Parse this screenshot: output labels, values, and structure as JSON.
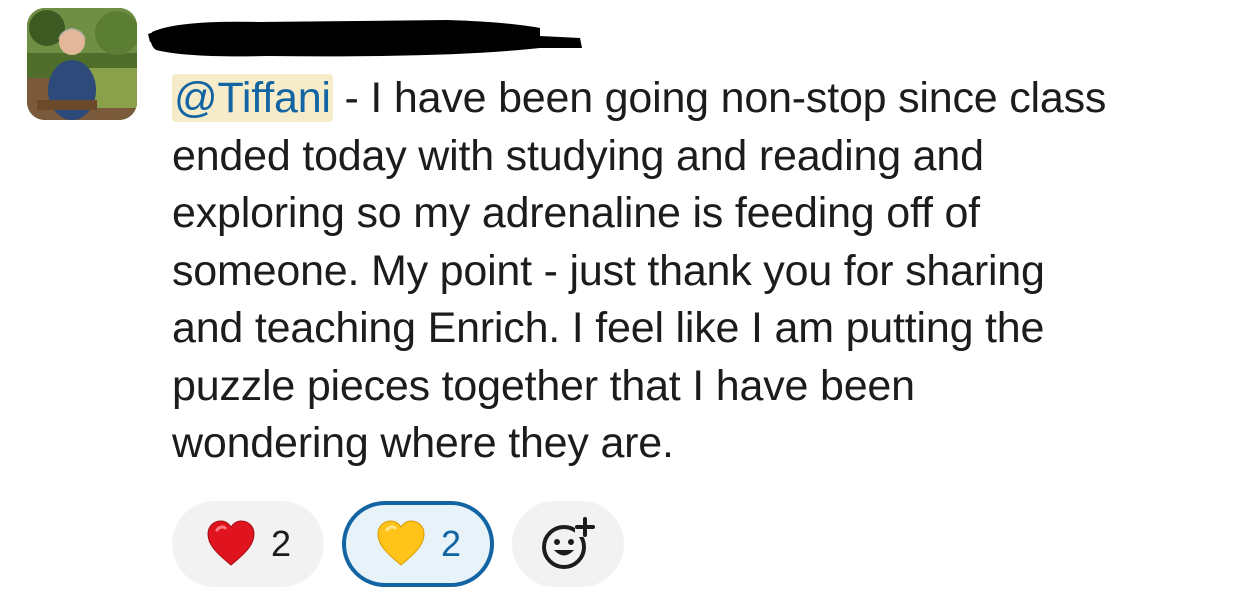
{
  "message": {
    "mention": "@Tiffani",
    "lines": [
      " - I have been going non-stop since class",
      "ended today with studying and reading and",
      "exploring so my adrenaline is feeding off of",
      "someone. My point - just thank you for sharing",
      "and teaching Enrich. I feel like I am putting the",
      "puzzle pieces together that I have been",
      "wondering where they are."
    ]
  },
  "reactions": [
    {
      "emoji": "red-heart-icon",
      "count": "2",
      "selected": false
    },
    {
      "emoji": "yellow-heart-icon",
      "count": "2",
      "selected": true
    }
  ],
  "colors": {
    "mention_text": "#1264a3",
    "mention_bg": "#f6ecc9",
    "selected_reaction_border": "#1264a3"
  }
}
